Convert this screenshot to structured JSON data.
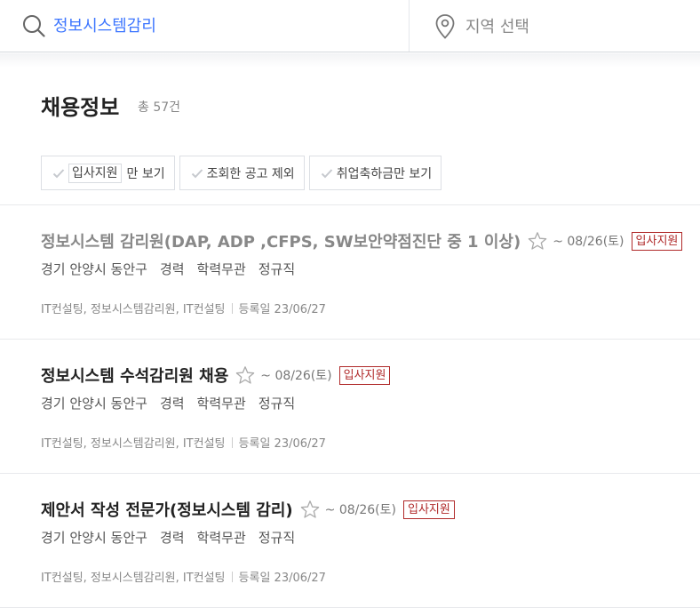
{
  "search": {
    "keyword": "정보시스템감리",
    "region_placeholder": "지역 선택"
  },
  "section": {
    "title": "채용정보",
    "total": "총 57건"
  },
  "filters": [
    {
      "tag": "입사지원",
      "label": "만 보기"
    },
    {
      "label": "조회한 공고 제외"
    },
    {
      "label": "취업축하금만 보기"
    }
  ],
  "jobs": [
    {
      "title": "정보시스템 감리원(DAP, ADP ,CFPS, SW보안약점진단 중 1 이상)",
      "visited": true,
      "deadline": "~ 08/26(토)",
      "apply": "입사지원",
      "meta": [
        "경기 안양시 동안구",
        "경력",
        "학력무관",
        "정규직"
      ],
      "tags": "IT컨설팅, 정보시스템감리원, IT컨설팅",
      "registered": "등록일 23/06/27"
    },
    {
      "title": "정보시스템 수석감리원 채용",
      "visited": false,
      "deadline": "~ 08/26(토)",
      "apply": "입사지원",
      "meta": [
        "경기 안양시 동안구",
        "경력",
        "학력무관",
        "정규직"
      ],
      "tags": "IT컨설팅, 정보시스템감리원, IT컨설팅",
      "registered": "등록일 23/06/27"
    },
    {
      "title": "제안서 작성 전문가(정보시스템 감리)",
      "visited": false,
      "deadline": "~ 08/26(토)",
      "apply": "입사지원",
      "meta": [
        "경기 안양시 동안구",
        "경력",
        "학력무관",
        "정규직"
      ],
      "tags": "IT컨설팅, 정보시스템감리원, IT컨설팅",
      "registered": "등록일 23/06/27"
    }
  ],
  "colors": {
    "accent": "#3d76ff",
    "apply": "#b02a2a"
  }
}
